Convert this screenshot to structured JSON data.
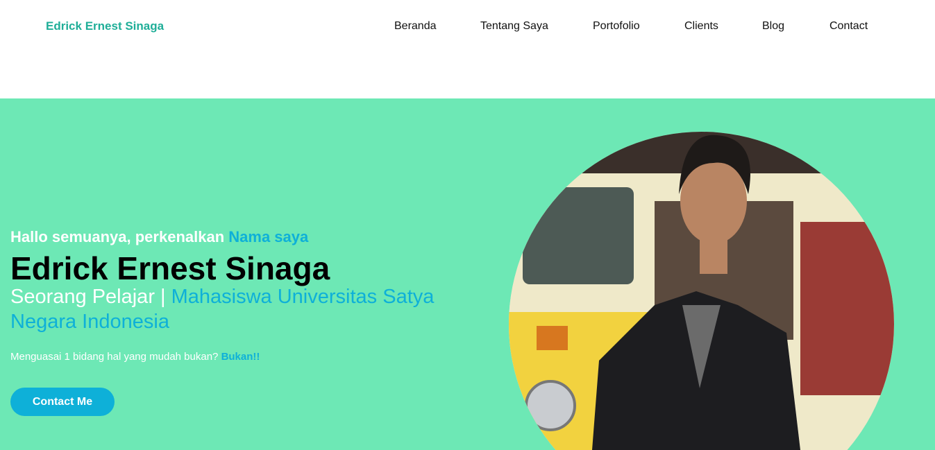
{
  "header": {
    "brand": "Edrick Ernest Sinaga",
    "menu": [
      "Beranda",
      "Tentang Saya",
      "Portofolio",
      "Clients",
      "Blog",
      "Contact"
    ]
  },
  "hero": {
    "greeting": "Hallo semuanya, perkenalkan ",
    "greeting_accent": "Nama saya",
    "name": "Edrick Ernest Sinaga",
    "subtitle": "Seorang Pelajar | ",
    "subtitle_accent": "Mahasiswa Universitas Satya Negara Indonesia",
    "tagline": "Menguasai 1 bidang hal yang mudah bukan? ",
    "tagline_accent": "Bukan!!",
    "button": "Contact Me"
  },
  "colors": {
    "brand": "#1fae98",
    "hero_bg": "#6de8b5",
    "accent": "#0eb0d8"
  }
}
